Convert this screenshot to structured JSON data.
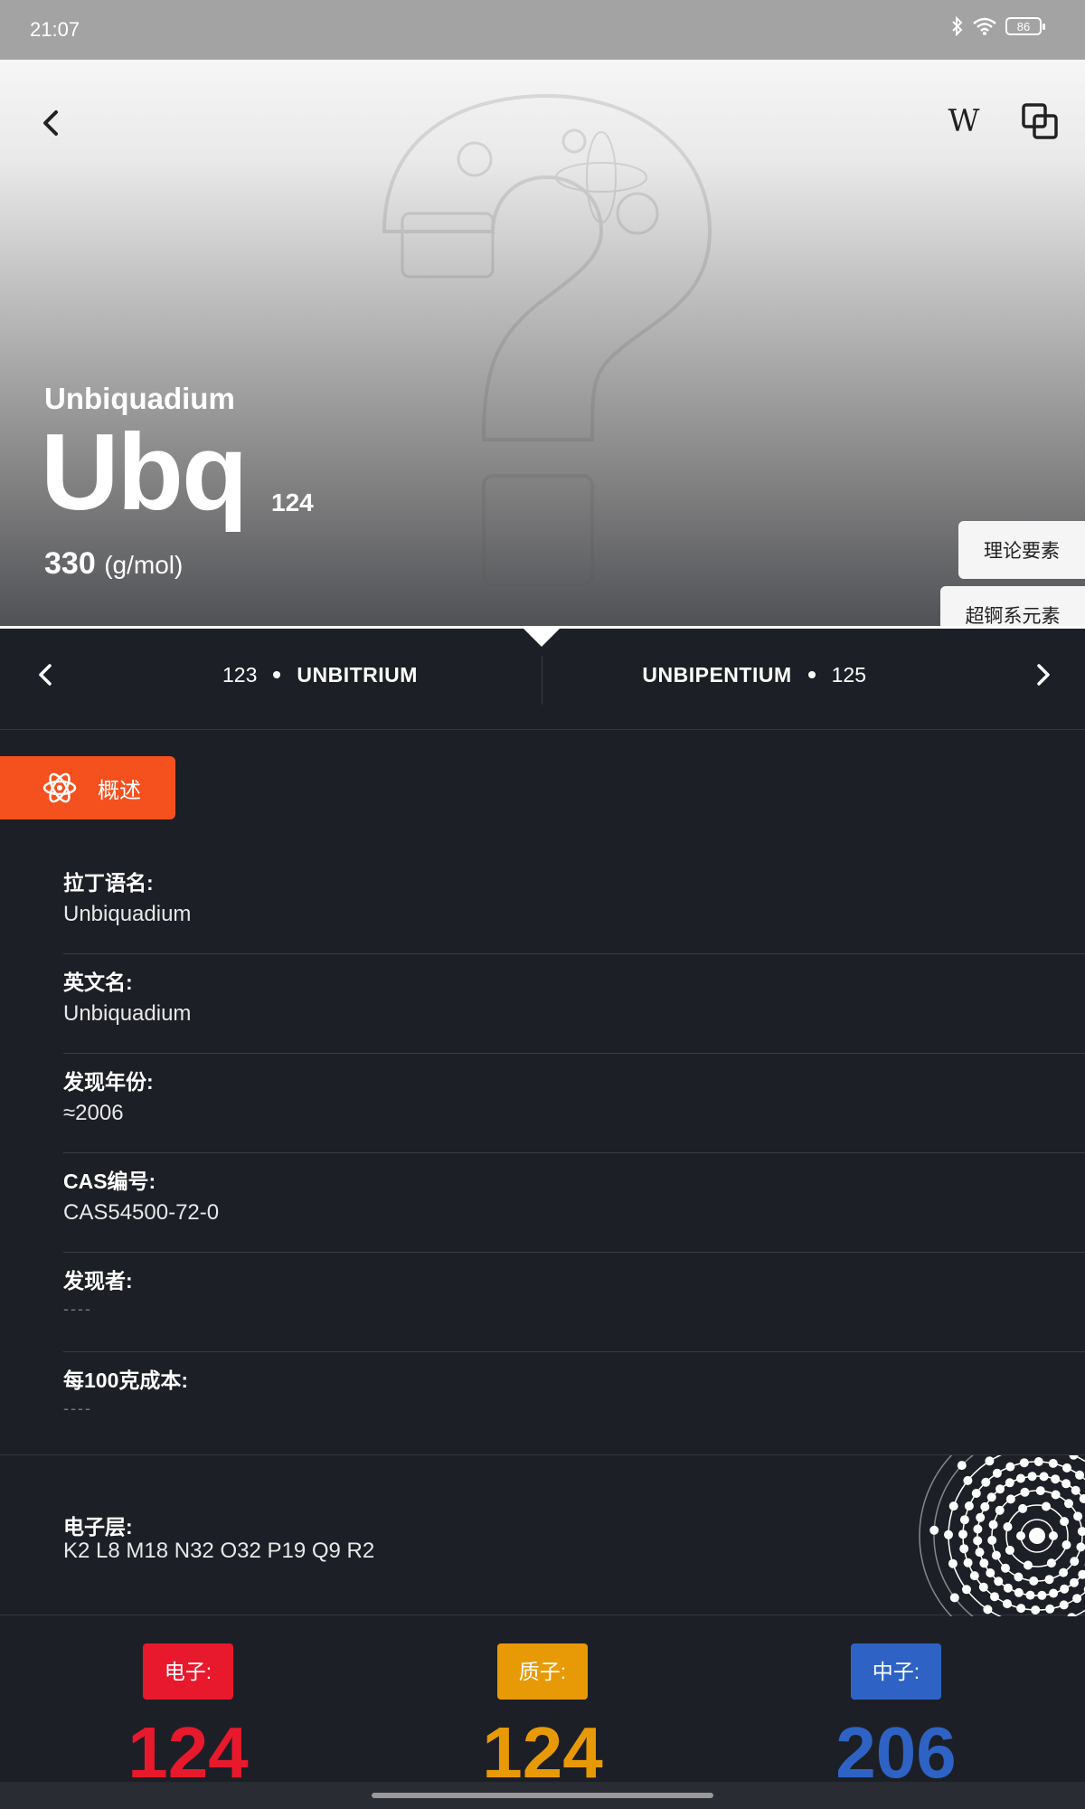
{
  "status_bar": {
    "time": "21:07",
    "battery": "86"
  },
  "element": {
    "name": "Unbiquadium",
    "symbol": "Ubq",
    "number": "124",
    "mass_value": "330",
    "mass_unit": "(g/mol)",
    "tags": [
      "理论要素",
      "超锕系元素"
    ]
  },
  "header": {
    "wiki_label": "W"
  },
  "nav": {
    "prev_number": "123",
    "prev_name": "UNBITRIUM",
    "next_name": "UNBIPENTIUM",
    "next_number": "125"
  },
  "section": {
    "label": "概述"
  },
  "info": [
    {
      "key": "拉丁语名:",
      "value": "Unbiquadium"
    },
    {
      "key": "英文名:",
      "value": "Unbiquadium"
    },
    {
      "key": "发现年份:",
      "value": "≈2006"
    },
    {
      "key": "CAS编号:",
      "value": "CAS54500-72-0"
    },
    {
      "key": "发现者:",
      "value": "----"
    },
    {
      "key": "每100克成本:",
      "value": "----"
    }
  ],
  "shells": {
    "key": "电子层:",
    "value": "K2 L8 M18 N32 O32 P19 Q9 R2"
  },
  "counts": [
    {
      "label": "电子:",
      "value": "124",
      "color": "#e8192c"
    },
    {
      "label": "质子:",
      "value": "124",
      "color": "#e89a06"
    },
    {
      "label": "中子:",
      "value": "206",
      "color": "#2e63c5"
    }
  ]
}
